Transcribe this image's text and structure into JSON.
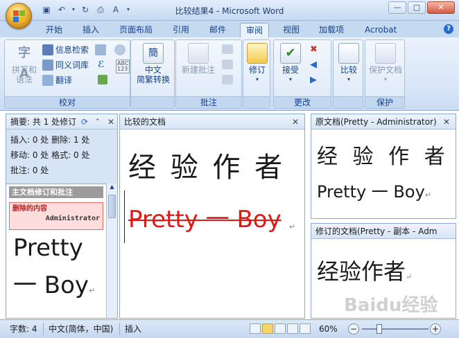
{
  "window": {
    "title": "比较结果4 - Microsoft Word",
    "min": "—",
    "max": "□",
    "close": "✕"
  },
  "qat": [
    "💾",
    "↶",
    "▾",
    "↻",
    "🔍",
    "A",
    "▾"
  ],
  "tabs": [
    "开始",
    "插入",
    "页面布局",
    "引用",
    "邮件",
    "审阅",
    "视图",
    "加载项",
    "Acrobat"
  ],
  "active_tab": "审阅",
  "help": "?",
  "ribbon": {
    "proofing": {
      "label": "校对",
      "spell": "拼写和\n语法",
      "research": "信息检索",
      "thesaurus": "同义词库",
      "translate": "翻译"
    },
    "chinese": {
      "label": "中文\n简繁转换",
      "icon": "簡"
    },
    "comments": {
      "label": "批注",
      "new": "新建批注"
    },
    "tracking": {
      "label": "修订"
    },
    "changes": {
      "label": "更改",
      "accept": "接受"
    },
    "compare": {
      "label": "比较"
    },
    "protect": {
      "label": "保护",
      "doc": "保护文档"
    }
  },
  "summary": {
    "header": "摘要: 共 1 处修订",
    "lines": [
      "插入: 0 处  删除: 1 处",
      "移动: 0 处  格式: 0 处",
      "批注: 0 处"
    ],
    "main_title": "主文档修订和批注",
    "deleted_label": "删除的内容",
    "author": "Administrator",
    "text1": "Pretty",
    "text2": "一 Boy"
  },
  "compared": {
    "header": "比较的文档",
    "line1": "经 验 作 者",
    "deleted": "Pretty 一 Boy"
  },
  "original": {
    "header": "原文档(Pretty - Administrator)",
    "line1": "经 验 作 者",
    "line2": "Pretty 一 Boy"
  },
  "revised": {
    "header": "修订的文档(Pretty - 副本 - Adm",
    "line1": "经验作者"
  },
  "status": {
    "words": "字数: 4",
    "lang": "中文(简体，中国)",
    "mode": "插入",
    "zoom": "60%"
  },
  "watermark": "Baidu经验"
}
